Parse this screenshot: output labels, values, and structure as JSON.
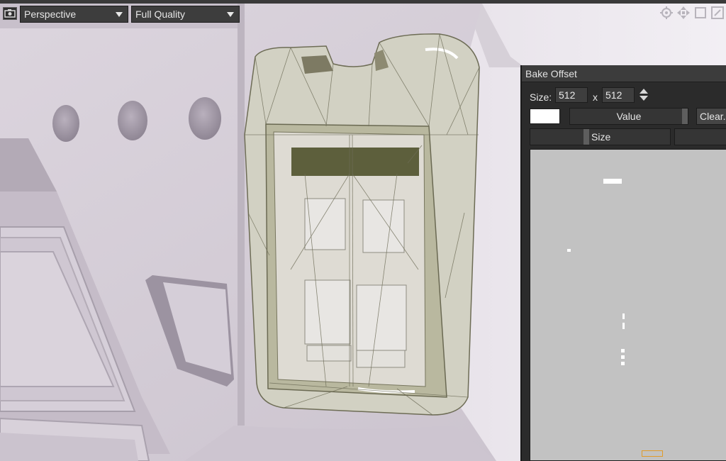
{
  "toolbar": {
    "camera_icon": "camera-icon",
    "view_mode": "Perspective",
    "quality": "Full Quality",
    "nav_icons": [
      "settings-icon",
      "move-icon",
      "frame-icon",
      "edit-icon"
    ]
  },
  "panel": {
    "title": "Bake Offset",
    "size_label": "Size:",
    "width_value": "512",
    "x_sep": "x",
    "height_value": "512",
    "swatch_color": "#ffffff",
    "value_label": "Value",
    "clear_label": "Clear...",
    "size_slider_label": "Size"
  }
}
